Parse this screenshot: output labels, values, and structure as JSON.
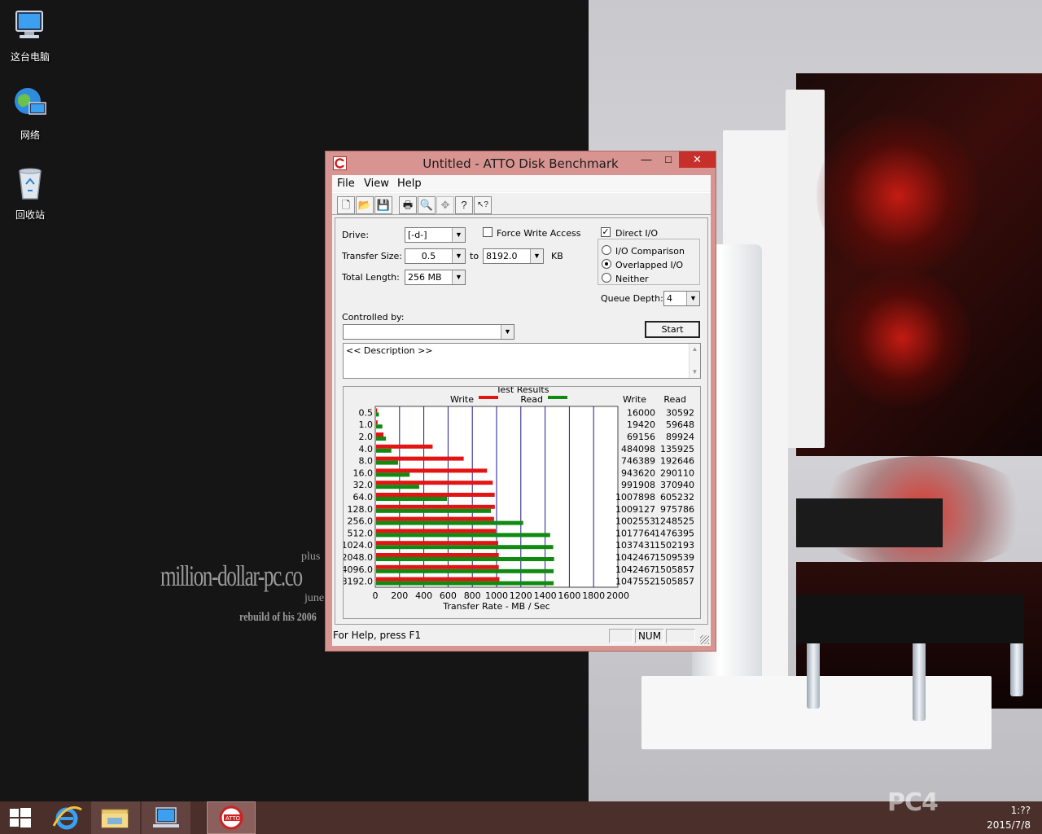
{
  "desktop": {
    "icons": [
      {
        "label": "这台电脑"
      },
      {
        "label": "网络"
      },
      {
        "label": "回收站"
      }
    ],
    "watermark": {
      "line1": "plus",
      "line2": "million-dollar-pc.co",
      "line3": "june",
      "line4": "rebuild of his 2006"
    },
    "brand": "PC4"
  },
  "window": {
    "title": "Untitled - ATTO Disk Benchmark",
    "minimize_glyph": "—",
    "maximize_glyph": "□",
    "close_glyph": "✕",
    "menu": [
      "File",
      "View",
      "Help"
    ],
    "toolbar": [
      {
        "icon": "new-document-icon",
        "glyph": "🗋"
      },
      {
        "icon": "open-folder-icon",
        "glyph": "📂"
      },
      {
        "icon": "save-icon",
        "glyph": "💾"
      },
      {
        "icon": "print-icon",
        "glyph": "🖶"
      },
      {
        "icon": "print-preview-icon",
        "glyph": "🔍"
      },
      {
        "icon": "move-icon",
        "glyph": "✥"
      },
      {
        "icon": "help-icon",
        "glyph": "?"
      },
      {
        "icon": "context-help-icon",
        "glyph": "↖?"
      }
    ],
    "form": {
      "drive_label": "Drive:",
      "drive_value": "[-d-]",
      "force_write_label": "Force Write Access",
      "force_write_checked": false,
      "direct_io_label": "Direct I/O",
      "direct_io_checked": true,
      "transfer_size_label": "Transfer Size:",
      "transfer_from": "0.5",
      "to_label": "to",
      "transfer_to": "8192.0",
      "kb_label": "KB",
      "total_length_label": "Total Length:",
      "total_length_value": "256 MB",
      "io_options": [
        {
          "label": "I/O Comparison",
          "selected": false
        },
        {
          "label": "Overlapped I/O",
          "selected": true
        },
        {
          "label": "Neither",
          "selected": false
        }
      ],
      "queue_depth_label": "Queue Depth:",
      "queue_depth_value": "4",
      "controlled_by_label": "Controlled by:",
      "controlled_by_value": "",
      "start_label": "Start",
      "description_text": "<< Description >>"
    },
    "status": {
      "help_text": "For Help, press F1",
      "cell1": "",
      "num": "NUM",
      "cell3": ""
    }
  },
  "chart_data": {
    "type": "bar",
    "orientation": "horizontal",
    "title": "Test Results",
    "xlabel": "Transfer Rate - MB / Sec",
    "xlim": [
      0,
      2000
    ],
    "xticks": [
      "0",
      "200",
      "400",
      "600",
      "800",
      "1000",
      "1200",
      "1400",
      "1600",
      "1800",
      "2000"
    ],
    "categories": [
      "0.5",
      "1.0",
      "2.0",
      "4.0",
      "8.0",
      "16.0",
      "32.0",
      "64.0",
      "128.0",
      "256.0",
      "512.0",
      "1024.0",
      "2048.0",
      "4096.0",
      "8192.0"
    ],
    "series": [
      {
        "name": "Write",
        "color": "#e31414",
        "values": [
          15.6,
          19.0,
          67.5,
          472.7,
          729.0,
          921.5,
          968.7,
          984.3,
          985.5,
          979.1,
          993.9,
          1013.1,
          1018.0,
          1018.0,
          1023.0
        ]
      },
      {
        "name": "Read",
        "color": "#118a11",
        "values": [
          29.9,
          58.2,
          87.8,
          132.7,
          188.1,
          283.3,
          362.2,
          591.0,
          952.9,
          1219.3,
          1441.8,
          1467.0,
          1474.2,
          1470.6,
          1470.6
        ]
      }
    ],
    "table": {
      "headers": [
        "Write",
        "Read"
      ],
      "write": [
        "16000",
        "19420",
        "69156",
        "484098",
        "746389",
        "943620",
        "991908",
        "1007898",
        "1009127",
        "1002553",
        "1017764",
        "1037431",
        "1042467",
        "1042467",
        "1047552"
      ],
      "read": [
        "30592",
        "59648",
        "89924",
        "135925",
        "192646",
        "290110",
        "370940",
        "605232",
        "975786",
        "1248525",
        "1476395",
        "1502193",
        "1509539",
        "1505857",
        "1505857"
      ]
    },
    "grid": true,
    "legend": "top"
  },
  "clock": {
    "time": "1:??",
    "date": "2015/7/8"
  }
}
